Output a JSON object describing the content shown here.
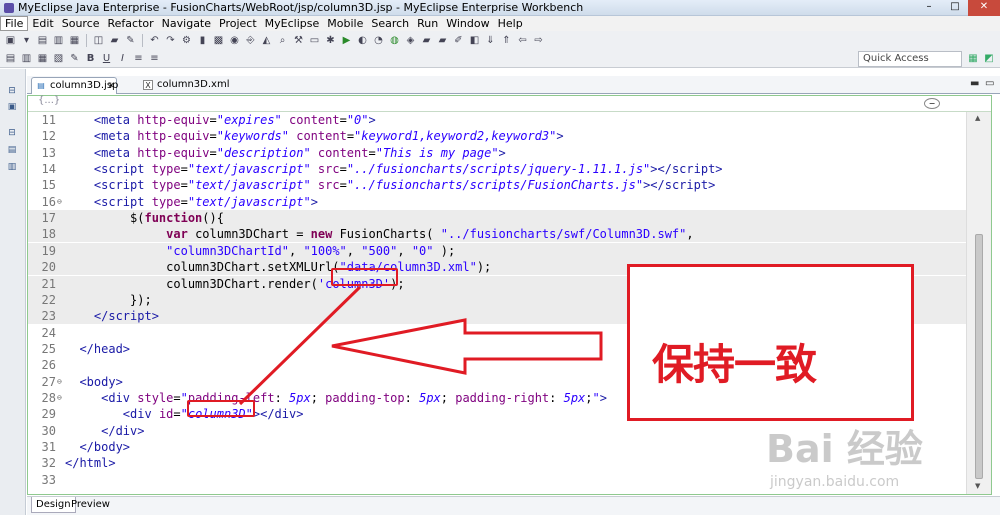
{
  "window": {
    "title": "MyEclipse Java Enterprise - FusionCharts/WebRoot/jsp/column3D.jsp - MyEclipse Enterprise Workbench",
    "minimize": "–",
    "maximize": "□",
    "close": "✕"
  },
  "menu": [
    "File",
    "Edit",
    "Source",
    "Refactor",
    "Navigate",
    "Project",
    "MyEclipse",
    "Mobile",
    "Search",
    "Run",
    "Window",
    "Help"
  ],
  "quick_access": {
    "placeholder": "Quick Access"
  },
  "tabs": [
    {
      "label": "column3D.jsp"
    },
    {
      "label": "column3D.xml"
    }
  ],
  "bottom_tabs": [
    "Design",
    "Preview"
  ],
  "code_lines": [
    {
      "n": "11",
      "html": "    <span class='tag'>&lt;meta</span> <span class='attr'>http-equiv</span>=<span class='str'>\"expires\"</span> <span class='attr'>content</span>=<span class='str'>\"0\"</span><span class='tag'>&gt;</span>"
    },
    {
      "n": "12",
      "html": "    <span class='tag'>&lt;meta</span> <span class='attr'>http-equiv</span>=<span class='str'>\"keywords\"</span> <span class='attr'>content</span>=<span class='str'>\"keyword1,keyword2,keyword3\"</span><span class='tag'>&gt;</span>"
    },
    {
      "n": "13",
      "html": "    <span class='tag'>&lt;meta</span> <span class='attr'>http-equiv</span>=<span class='str'>\"description\"</span> <span class='attr'>content</span>=<span class='str'>\"This is my page\"</span><span class='tag'>&gt;</span>"
    },
    {
      "n": "14",
      "html": "    <span class='tag'>&lt;script</span> <span class='attr'>type</span>=<span class='str'>\"text/javascript\"</span> <span class='attr'>src</span>=<span class='str'>\"../fusioncharts/scripts/jquery-1.11.1.js\"</span><span class='tag'>&gt;&lt;/script&gt;</span>"
    },
    {
      "n": "15",
      "html": "    <span class='tag'>&lt;script</span> <span class='attr'>type</span>=<span class='str'>\"text/javascript\"</span> <span class='attr'>src</span>=<span class='str'>\"../fusioncharts/scripts/FusionCharts.js\"</span><span class='tag'>&gt;&lt;/script&gt;</span>"
    },
    {
      "n": "16",
      "fold": true,
      "html": "    <span class='tag'>&lt;script</span> <span class='attr'>type</span>=<span class='str'>\"text/javascript\"</span><span class='tag'>&gt;</span>"
    },
    {
      "n": "17",
      "gray": true,
      "html": "         $(<span class='kw'>function</span>(){"
    },
    {
      "n": "18",
      "gray": true,
      "html": "              <span class='kw'>var</span> column3DChart = <span class='kw'>new</span> FusionCharts( <span class='jsstr'>\"../fusioncharts/swf/Column3D.swf\"</span>,"
    },
    {
      "n": "19",
      "gray": true,
      "html": "              <span class='jsstr'>\"column3DChartId\"</span>, <span class='jsstr'>\"100%\"</span>, <span class='jsstr'>\"500\"</span>, <span class='jsstr'>\"0\"</span> );"
    },
    {
      "n": "20",
      "gray": true,
      "html": "              column3DChart.setXMLUrl(<span class='jsstr'>\"data/column3D.xml\"</span>);"
    },
    {
      "n": "21",
      "gray": true,
      "html": "              column3DChart.render(<span class='jsstr'>'column3D'</span>);"
    },
    {
      "n": "22",
      "gray": true,
      "html": "         });"
    },
    {
      "n": "23",
      "gray": true,
      "html": "    <span class='tag'>&lt;/script&gt;</span>"
    },
    {
      "n": "24",
      "html": ""
    },
    {
      "n": "25",
      "html": "  <span class='tag'>&lt;/head&gt;</span>"
    },
    {
      "n": "26",
      "html": ""
    },
    {
      "n": "27",
      "fold": true,
      "html": "  <span class='tag'>&lt;body&gt;</span>"
    },
    {
      "n": "28",
      "fold": true,
      "html": "     <span class='tag'>&lt;div</span> <span class='attr'>style</span>=<span class='str'>\"</span><span class='attr'>padding-left</span>: <span class='str'>5px</span>; <span class='attr'>padding-top</span>: <span class='str'>5px</span>; <span class='attr'>padding-right</span>: <span class='str'>5px</span>;<span class='str'>\"</span><span class='tag'>&gt;</span>"
    },
    {
      "n": "29",
      "html": "        <span class='tag'>&lt;div</span> <span class='attr'>id</span>=<span class='str'>\"column3D\"</span><span class='tag'>&gt;&lt;/div&gt;</span>"
    },
    {
      "n": "30",
      "html": "     <span class='tag'>&lt;/div&gt;</span>"
    },
    {
      "n": "31",
      "html": "  <span class='tag'>&lt;/body&gt;</span>"
    },
    {
      "n": "32",
      "html": "<span class='tag'>&lt;/html&gt;</span>"
    },
    {
      "n": "33",
      "html": ""
    }
  ],
  "annotation": {
    "text": "保持一致",
    "color": "#e01b24"
  },
  "watermark": {
    "brand": "Bai 经验",
    "url": "jingyan.baidu.com"
  },
  "toolbar_icons": [
    "new-icon",
    "save-icon",
    "save-all-icon",
    "print-icon",
    "undo-icon",
    "build-icon",
    "debug-icon",
    "run-icon",
    "search-icon",
    "open-type-icon",
    "server-icon",
    "browser-icon"
  ],
  "perspective_icons": [
    "java-ee-perspective-icon",
    "myeclipse-perspective-icon"
  ]
}
